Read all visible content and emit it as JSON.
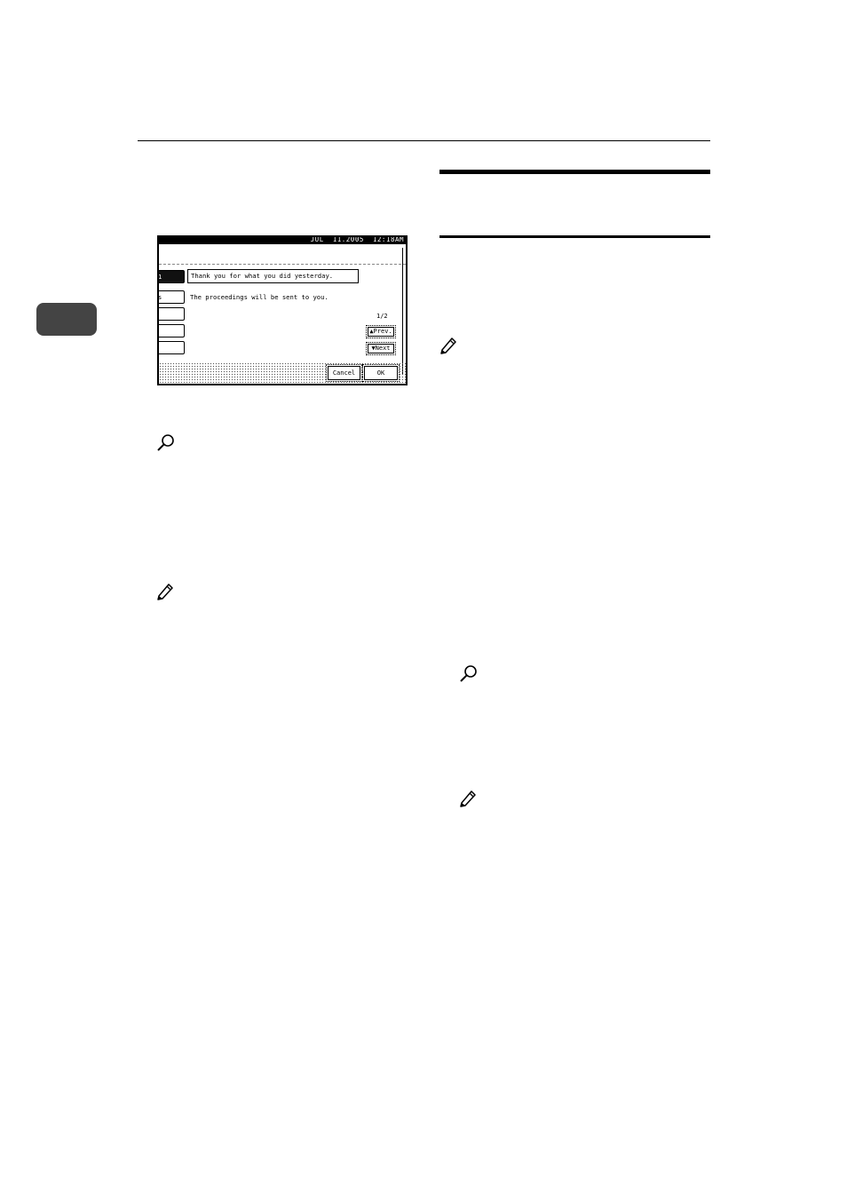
{
  "screen": {
    "date_time": "JUL  11.2005  12:18AM",
    "left_buttons": [
      "1",
      "s",
      "",
      "",
      ""
    ],
    "message_1": "Thank you for what you did yesterday.",
    "message_2": "The proceedings will be sent to you.",
    "page_counter": "1/2",
    "prev_label": "▲Prev.",
    "next_label": "▼Next",
    "cancel_label": "Cancel",
    "ok_label": "OK"
  },
  "icons": {
    "reference_icon": "magnifier-icon",
    "note_icon": "pencil-icon"
  },
  "colors": {
    "ink": "#000000",
    "chapter_tab": "#444444"
  }
}
